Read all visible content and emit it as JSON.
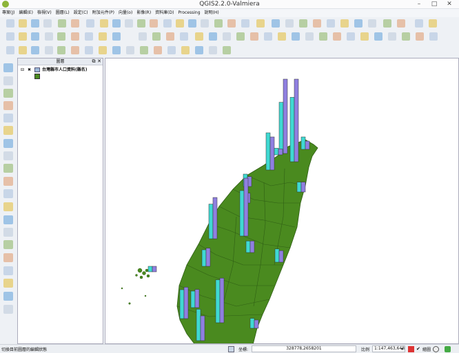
{
  "window": {
    "title": "QGIS2.2.0-Valmiera",
    "minimize": "–",
    "maximize": "□",
    "close": "✕"
  },
  "menu": [
    "專案(J)",
    "編輯(E)",
    "檢視(V)",
    "圖層(L)",
    "設定(C)",
    "附加元件(P)",
    "向量(o)",
    "影像(R)",
    "資料庫(D)",
    "Processing",
    "說明(H)"
  ],
  "layers_panel": {
    "title": "圖層",
    "float_label": "⧉",
    "close_label": "✕",
    "layer_name": "台灣縣市人口資料(縣名)",
    "expand_label": "⊟",
    "checked_label": "✖",
    "fill_color": "#4a8a1f"
  },
  "map": {
    "land_color": "#4a8a1f",
    "bar_colors": [
      "#3fd9d2",
      "#8f7fe0"
    ],
    "regions": [
      {
        "name": "taipei",
        "values": [
          0.78,
          1.0
        ]
      },
      {
        "name": "newtaipei",
        "values": [
          0.62,
          0.9
        ]
      },
      {
        "name": "keelung",
        "values": [
          0.15,
          0.1
        ]
      },
      {
        "name": "taoyuan",
        "values": [
          0.45,
          0.4
        ]
      },
      {
        "name": "hsinchu",
        "values": [
          0.15,
          0.12
        ]
      },
      {
        "name": "yilan",
        "values": [
          0.12,
          0.12
        ]
      },
      {
        "name": "miaoli",
        "values": [
          0.14,
          0.12
        ]
      },
      {
        "name": "taichung",
        "values": [
          0.55,
          0.7
        ]
      },
      {
        "name": "changhua",
        "values": [
          0.42,
          0.5
        ]
      },
      {
        "name": "nantou",
        "values": [
          0.14,
          0.14
        ]
      },
      {
        "name": "yunlin",
        "values": [
          0.2,
          0.22
        ]
      },
      {
        "name": "chiayi",
        "values": [
          0.16,
          0.14
        ]
      },
      {
        "name": "tainan",
        "values": [
          0.35,
          0.38
        ]
      },
      {
        "name": "kaohsiung",
        "values": [
          0.52,
          0.54
        ]
      },
      {
        "name": "pingtung",
        "values": [
          0.2,
          0.22
        ]
      },
      {
        "name": "hualien",
        "values": [
          0.12,
          0.1
        ]
      },
      {
        "name": "taitung",
        "values": [
          0.08,
          0.07
        ]
      },
      {
        "name": "penghu",
        "values": [
          0.06,
          0.06
        ]
      },
      {
        "name": "south",
        "values": [
          0.38,
          0.3
        ]
      }
    ]
  },
  "status": {
    "message": "切換目前圖層的編輯狀態",
    "coord_label": "坐標:",
    "coord_value": "328778,2658201",
    "scale_label": "比例",
    "scale_value": "1:147,463,648",
    "render_label": "繪圖"
  }
}
